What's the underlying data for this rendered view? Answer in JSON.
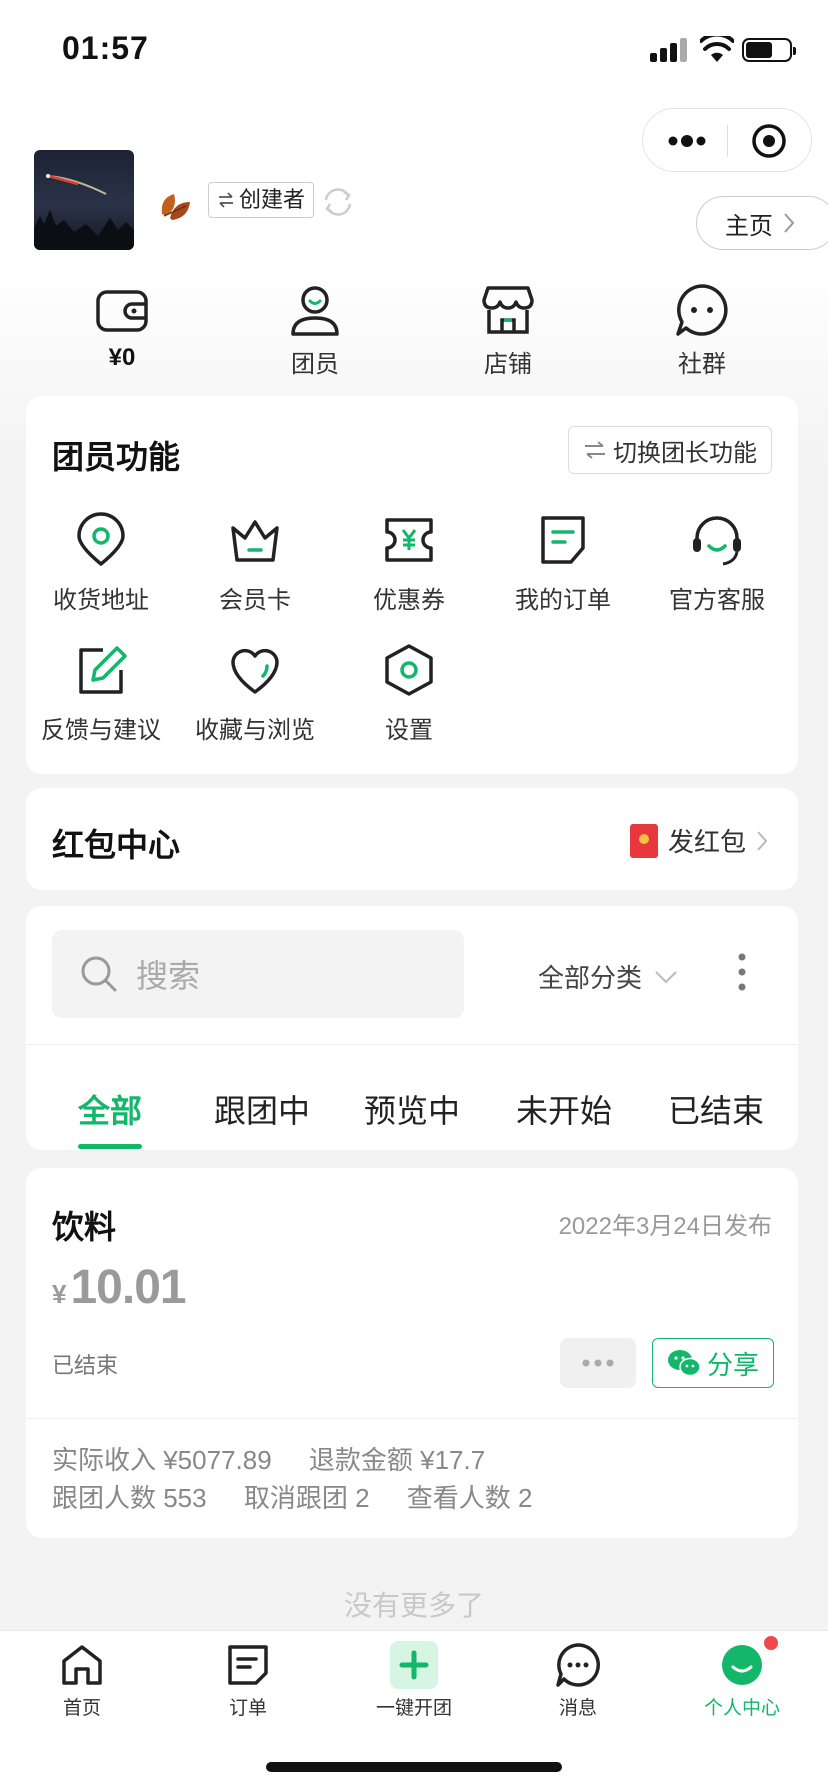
{
  "status_bar": {
    "time": "01:57"
  },
  "header": {
    "role_tag": "创建者",
    "home_label": "主页"
  },
  "quick_stats": [
    {
      "label": "¥0",
      "icon": "wallet-icon"
    },
    {
      "label": "团员",
      "icon": "user-icon"
    },
    {
      "label": "店铺",
      "icon": "store-icon"
    },
    {
      "label": "社群",
      "icon": "chat-bubble-icon"
    }
  ],
  "member_functions": {
    "title": "团员功能",
    "switch_label": "切换团长功能",
    "items": [
      {
        "label": "收货地址",
        "icon": "location-pin-icon"
      },
      {
        "label": "会员卡",
        "icon": "crown-icon"
      },
      {
        "label": "优惠券",
        "icon": "coupon-icon"
      },
      {
        "label": "我的订单",
        "icon": "order-icon"
      },
      {
        "label": "官方客服",
        "icon": "headset-icon"
      },
      {
        "label": "反馈与建议",
        "icon": "edit-icon"
      },
      {
        "label": "收藏与浏览",
        "icon": "heart-icon"
      },
      {
        "label": "设置",
        "icon": "settings-hexagon-icon"
      }
    ]
  },
  "red_packet": {
    "title": "红包中心",
    "action_label": "发红包"
  },
  "search": {
    "placeholder": "搜索",
    "category_label": "全部分类",
    "tabs": [
      "全部",
      "跟团中",
      "预览中",
      "未开始",
      "已结束"
    ],
    "active_tab": 0
  },
  "product": {
    "title": "饮料",
    "date": "2022年3月24日发布",
    "currency": "¥",
    "price": "10.01",
    "status": "已结束",
    "share_label": "分享",
    "stats_line1": [
      "实际收入 ¥5077.89",
      "退款金额 ¥17.7"
    ],
    "stats_line2": [
      "跟团人数 553",
      "取消跟团 2",
      "查看人数 2"
    ]
  },
  "footer_text": "没有更多了",
  "tabbar": [
    {
      "label": "首页",
      "icon": "home-icon"
    },
    {
      "label": "订单",
      "icon": "order-icon"
    },
    {
      "label": "一键开团",
      "icon": "plus-icon"
    },
    {
      "label": "消息",
      "icon": "message-icon"
    },
    {
      "label": "个人中心",
      "icon": "profile-smile-icon"
    }
  ],
  "colors": {
    "accent": "#12b76a",
    "badge": "#f0484d"
  }
}
